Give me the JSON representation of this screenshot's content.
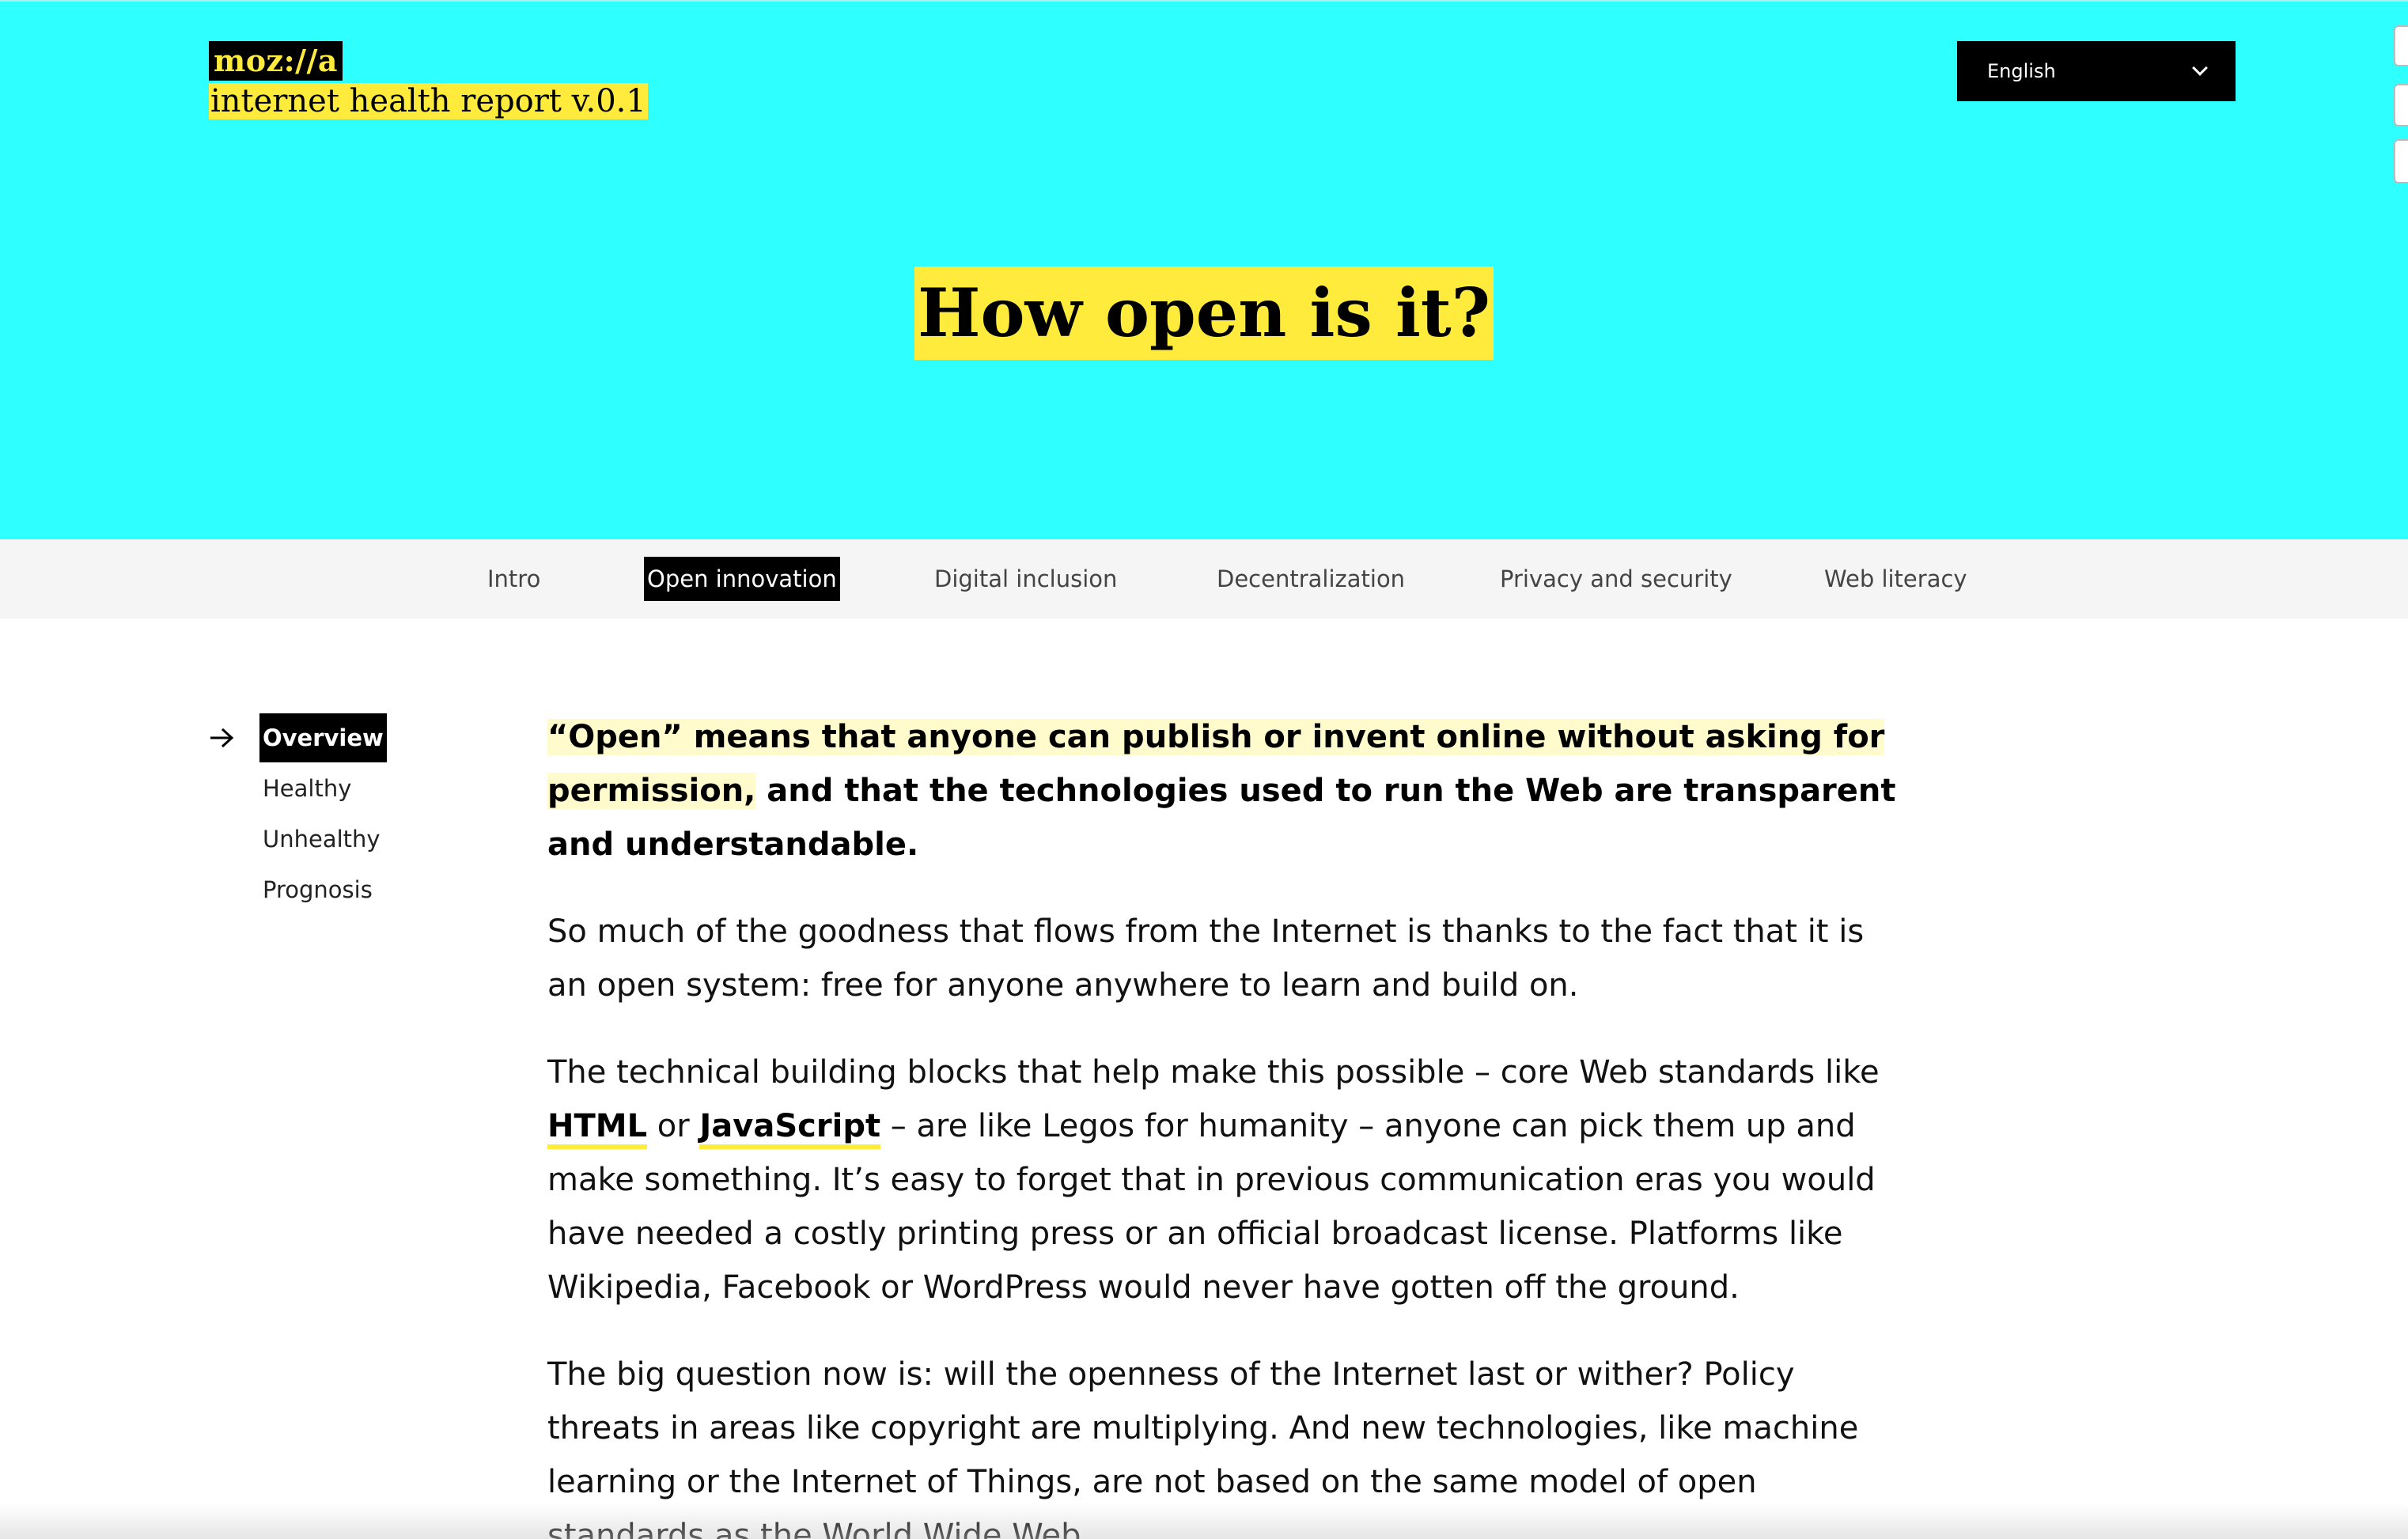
{
  "header": {
    "logo_text": "moz://a",
    "report_title": "internet health report v.0.1",
    "language": {
      "selected": "English"
    }
  },
  "hero": {
    "heading": "How open is it?"
  },
  "tabs": [
    {
      "label": "Intro",
      "active": false
    },
    {
      "label": "Open innovation",
      "active": true
    },
    {
      "label": "Digital inclusion",
      "active": false
    },
    {
      "label": "Decentralization",
      "active": false
    },
    {
      "label": "Privacy and security",
      "active": false
    },
    {
      "label": "Web literacy",
      "active": false
    }
  ],
  "section_nav": [
    {
      "label": "Overview",
      "active": true
    },
    {
      "label": "Healthy",
      "active": false
    },
    {
      "label": "Unhealthy",
      "active": false
    },
    {
      "label": "Prognosis",
      "active": false
    }
  ],
  "content": {
    "lede_highlight": "“Open” means that anyone can publish or invent online without asking for permission,",
    "lede_rest": " and that the technologies used to run the Web are transparent and understandable.",
    "p1": "So much of the goodness that flows from the Internet is thanks to the fact that it is an open system: free for anyone anywhere to learn and build on.",
    "p2_a": "The technical building blocks that help make this possible – core Web standards like ",
    "p2_link1": "HTML",
    "p2_b": " or ",
    "p2_link2": "JavaScript",
    "p2_c": " – are like Legos for humanity – anyone can pick them up and make something. It’s easy to forget that in previous communication eras you would have needed a costly printing press or an official broadcast license. Platforms like Wikipedia, Facebook or WordPress would never have gotten off the ground.",
    "p3": "The big question now is: will the openness of the Internet last or wither? Policy threats in areas like copyright are multiplying. And new technologies, like machine learning or the Internet of Things, are not based on the same model of open standards as the World Wide Web."
  },
  "colors": {
    "hero_bg": "#2effff",
    "highlight": "#ffeb3b",
    "lede_highlight": "#fffbcc",
    "tabbar_bg": "#f5f5f5"
  },
  "icons": {
    "language_dropdown": "chevron-down-icon",
    "current_section": "arrow-right-icon"
  }
}
